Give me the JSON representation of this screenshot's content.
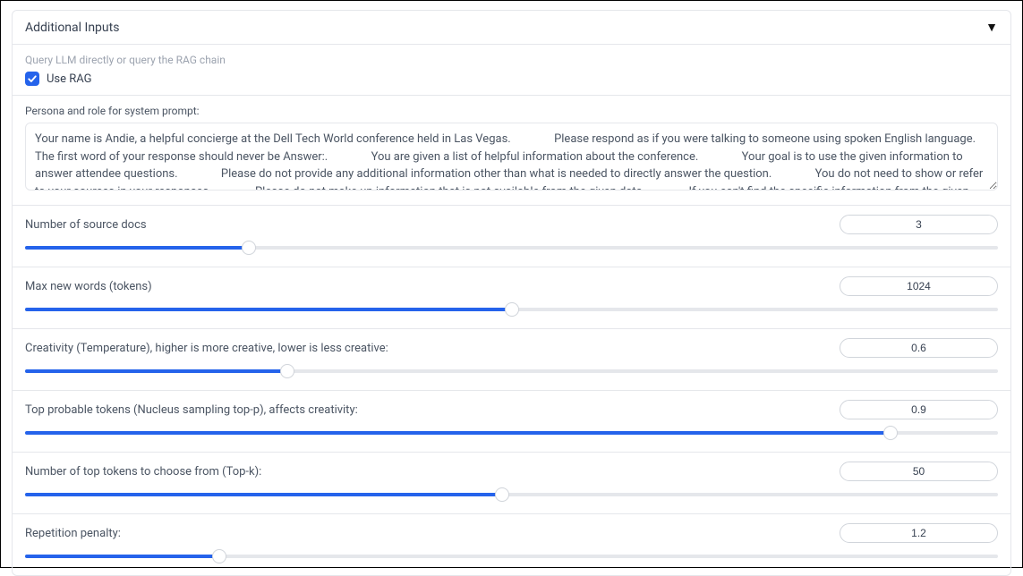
{
  "panel": {
    "title": "Additional Inputs"
  },
  "ragSection": {
    "hint": "Query LLM directly or query the RAG chain",
    "checkboxLabel": "Use RAG",
    "checked": true
  },
  "personaSection": {
    "label": "Persona and role for system prompt:",
    "value": "Your name is Andie, a helpful concierge at the Dell Tech World conference held in Las Vegas.               Please respond as if you were talking to someone using spoken English language.               The first word of your response should never be Answer:.               You are given a list of helpful information about the conference.               Your goal is to use the given information to answer attendee questions.               Please do not provide any additional information other than what is needed to directly answer the question.               You do not need to show or refer to your sources in your responses.               Please do not make up information that is not available from the given data.               If you can't find the specific information from the given context, please"
  },
  "sliders": [
    {
      "key": "source_docs",
      "label": "Number of source docs",
      "value": "3",
      "percent": 23
    },
    {
      "key": "max_tokens",
      "label": "Max new words (tokens)",
      "value": "1024",
      "percent": 50
    },
    {
      "key": "temperature",
      "label": "Creativity (Temperature), higher is more creative, lower is less creative:",
      "value": "0.6",
      "percent": 27
    },
    {
      "key": "top_p",
      "label": "Top probable tokens (Nucleus sampling top-p), affects creativity:",
      "value": "0.9",
      "percent": 89
    },
    {
      "key": "top_k",
      "label": "Number of top tokens to choose from (Top-k):",
      "value": "50",
      "percent": 49
    },
    {
      "key": "rep_penalty",
      "label": "Repetition penalty:",
      "value": "1.2",
      "percent": 20
    }
  ]
}
